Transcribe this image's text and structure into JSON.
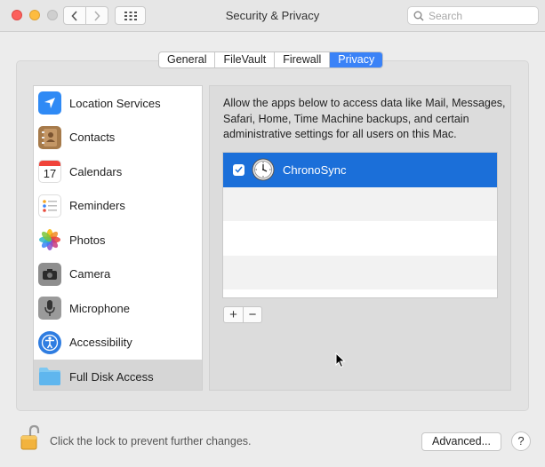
{
  "window": {
    "title": "Security & Privacy"
  },
  "search": {
    "placeholder": "Search"
  },
  "tabs": [
    {
      "label": "General"
    },
    {
      "label": "FileVault"
    },
    {
      "label": "Firewall"
    },
    {
      "label": "Privacy",
      "active": true
    }
  ],
  "sidebar": {
    "items": [
      {
        "label": "Location Services",
        "icon": "location-arrow-icon"
      },
      {
        "label": "Contacts",
        "icon": "contacts-book-icon"
      },
      {
        "label": "Calendars",
        "icon": "calendar-icon",
        "day": "17"
      },
      {
        "label": "Reminders",
        "icon": "reminders-list-icon"
      },
      {
        "label": "Photos",
        "icon": "photos-flower-icon"
      },
      {
        "label": "Camera",
        "icon": "camera-icon"
      },
      {
        "label": "Microphone",
        "icon": "microphone-icon"
      },
      {
        "label": "Accessibility",
        "icon": "accessibility-icon"
      },
      {
        "label": "Full Disk Access",
        "icon": "folder-icon",
        "selected": true
      }
    ]
  },
  "panel": {
    "description": "Allow the apps below to access data like Mail, Messages, Safari, Home, Time Machine backups, and certain administrative settings for all users on this Mac.",
    "apps": [
      {
        "name": "ChronoSync",
        "checked": true,
        "icon": "clock-icon"
      }
    ],
    "add_label": "+",
    "remove_label": "−"
  },
  "footer": {
    "lock_text": "Click the lock to prevent further changes.",
    "advanced_label": "Advanced...",
    "help_label": "?"
  },
  "colors": {
    "accent": "#3a82f7",
    "selection": "#1b6fd9"
  }
}
